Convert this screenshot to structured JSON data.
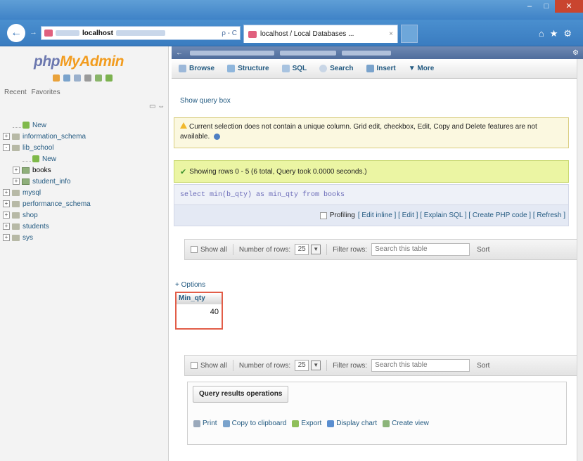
{
  "browser": {
    "address_host": "localhost",
    "address_controls": "ρ - C",
    "tab_title": "localhost / Local Databases ...",
    "tab_close": "×"
  },
  "nav": {
    "logo_php": "php",
    "logo_myadmin": "MyAdmin",
    "recent": "Recent",
    "favorites": "Favorites",
    "tree": [
      {
        "label": "New",
        "type": "new",
        "indent": 1,
        "expander": ""
      },
      {
        "label": "information_schema",
        "type": "db",
        "indent": 0,
        "expander": "+"
      },
      {
        "label": "lib_school",
        "type": "db",
        "indent": 0,
        "expander": "-"
      },
      {
        "label": "New",
        "type": "new",
        "indent": 2,
        "expander": ""
      },
      {
        "label": "books",
        "type": "table",
        "indent": 1,
        "expander": "+",
        "selected": true
      },
      {
        "label": "student_info",
        "type": "table",
        "indent": 1,
        "expander": "+"
      },
      {
        "label": "mysql",
        "type": "db",
        "indent": 0,
        "expander": "+"
      },
      {
        "label": "performance_schema",
        "type": "db",
        "indent": 0,
        "expander": "+"
      },
      {
        "label": "shop",
        "type": "db",
        "indent": 0,
        "expander": "+"
      },
      {
        "label": "students",
        "type": "db",
        "indent": 0,
        "expander": "+"
      },
      {
        "label": "sys",
        "type": "db",
        "indent": 0,
        "expander": "+"
      }
    ]
  },
  "menu": {
    "browse": "Browse",
    "structure": "Structure",
    "sql": "SQL",
    "search": "Search",
    "insert": "Insert",
    "more": "▼ More"
  },
  "main": {
    "show_query_box": "Show query box",
    "notice": "Current selection does not contain a unique column. Grid edit, checkbox, Edit, Copy and Delete features are not available.",
    "success": "Showing rows 0 - 5 (6 total, Query took 0.0000 seconds.)",
    "sql_query": "select min(b_qty) as min_qty from books",
    "profiling": "Profiling",
    "profiling_links": "[ Edit inline ] [ Edit ] [ Explain SQL ] [ Create PHP code ] [ Refresh ]",
    "show_all": "Show all",
    "number_of_rows": "Number of rows:",
    "rows_value": "25",
    "filter_rows": "Filter rows:",
    "filter_placeholder": "Search this table",
    "sort": "Sort",
    "options": "+ Options",
    "result_header": "Min_qty",
    "result_value": "40",
    "qro_title": "Query results operations",
    "qro_print": "Print",
    "qro_copy": "Copy to clipboard",
    "qro_export": "Export",
    "qro_chart": "Display chart",
    "qro_view": "Create view"
  },
  "colors": {
    "highlight_box": "#e25d48",
    "success_bg": "#ebf5a3",
    "link": "#235a81"
  }
}
